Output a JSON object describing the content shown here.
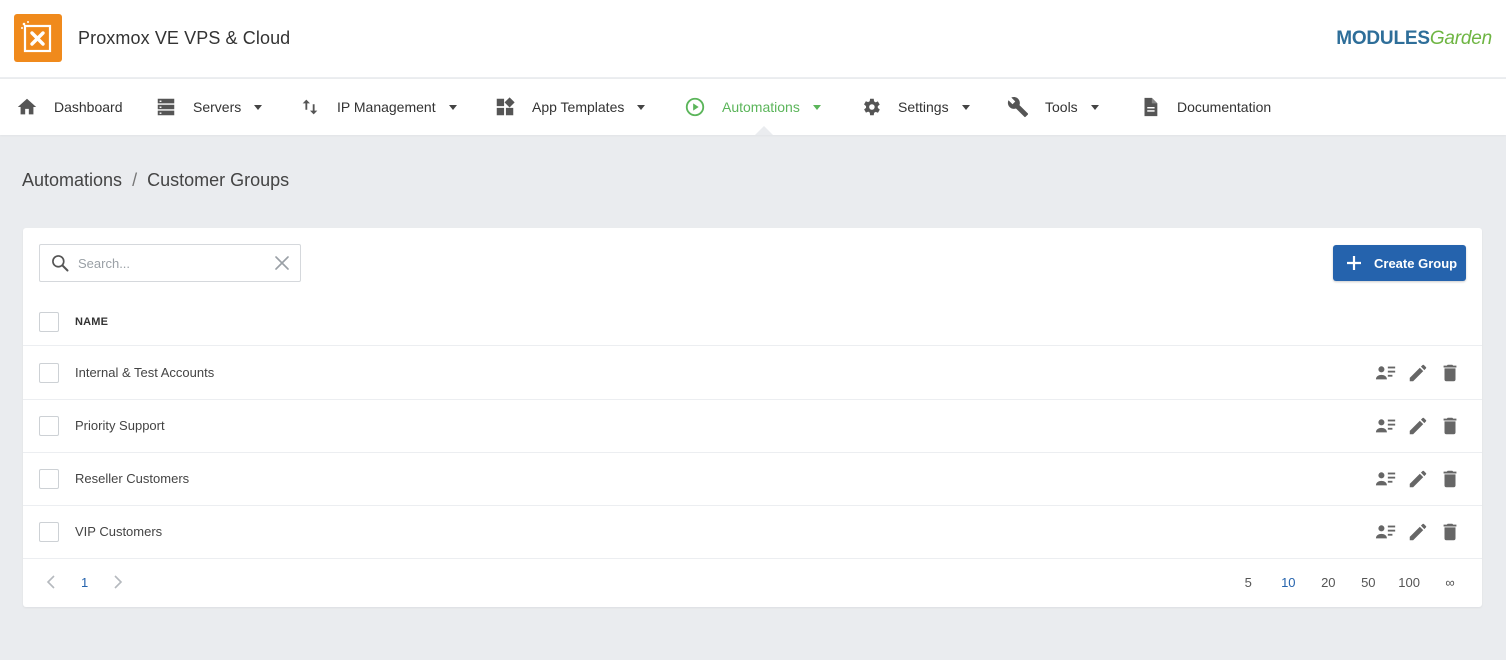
{
  "app": {
    "title": "Proxmox VE VPS & Cloud",
    "brand_part1": "MODULES",
    "brand_part2": "Garden",
    "logo_color": "#f08a1c"
  },
  "nav": {
    "items": [
      {
        "label": "Dashboard",
        "icon": "home-icon",
        "dropdown": false
      },
      {
        "label": "Servers",
        "icon": "server-icon",
        "dropdown": true
      },
      {
        "label": "IP Management",
        "icon": "swap-vertical-icon",
        "dropdown": true
      },
      {
        "label": "App Templates",
        "icon": "widgets-icon",
        "dropdown": true
      },
      {
        "label": "Automations",
        "icon": "play-circle-icon",
        "dropdown": true,
        "active": true
      },
      {
        "label": "Settings",
        "icon": "gear-icon",
        "dropdown": true
      },
      {
        "label": "Tools",
        "icon": "wrench-icon",
        "dropdown": true
      },
      {
        "label": "Documentation",
        "icon": "document-icon",
        "dropdown": false
      }
    ],
    "active_color": "#5bb55a"
  },
  "breadcrumb": {
    "parent": "Automations",
    "separator": "/",
    "current": "Customer Groups"
  },
  "toolbar": {
    "search_placeholder": "Search...",
    "search_value": "",
    "create_label": "Create Group",
    "create_color": "#2563ad"
  },
  "table": {
    "columns": [
      "NAME"
    ],
    "rows": [
      {
        "name": "Internal & Test Accounts"
      },
      {
        "name": "Priority Support"
      },
      {
        "name": "Reseller Customers"
      },
      {
        "name": "VIP Customers"
      }
    ],
    "row_actions": [
      "members-icon",
      "edit-icon",
      "delete-icon"
    ]
  },
  "pagination": {
    "current_page": "1",
    "page_sizes": [
      "5",
      "10",
      "20",
      "50",
      "100",
      "∞"
    ],
    "active_size": "10"
  }
}
